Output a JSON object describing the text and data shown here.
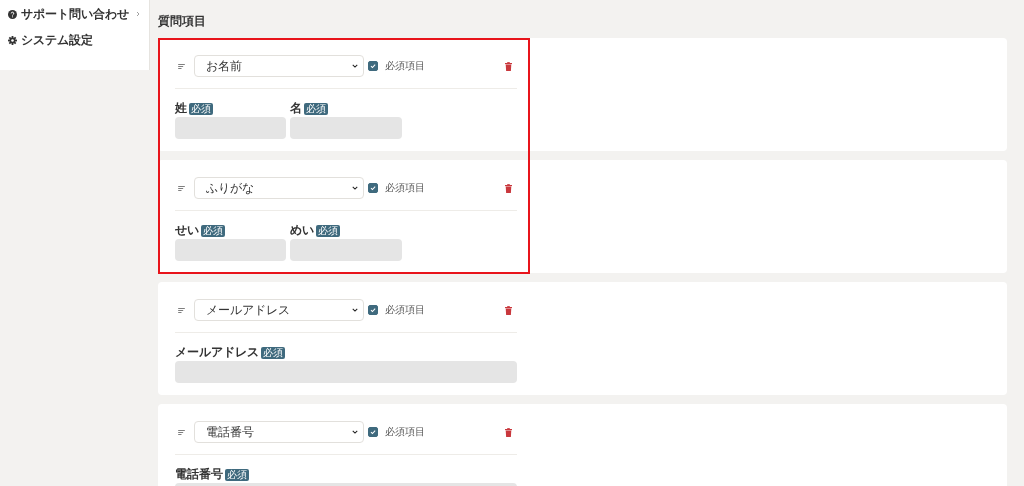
{
  "sidebar": {
    "items": [
      {
        "label": "サポート問い合わせ",
        "has_submenu": true
      },
      {
        "label": "システム設定",
        "has_submenu": false
      }
    ]
  },
  "section_title": "質問項目",
  "cards": [
    {
      "highlighted": true,
      "type": "お名前",
      "required_label": "必須項目",
      "required": true,
      "fields": [
        {
          "label": "姓",
          "badge": "必須"
        },
        {
          "label": "名",
          "badge": "必須"
        }
      ]
    },
    {
      "highlighted": true,
      "type": "ふりがな",
      "required_label": "必須項目",
      "required": true,
      "fields": [
        {
          "label": "せい",
          "badge": "必須"
        },
        {
          "label": "めい",
          "badge": "必須"
        }
      ]
    },
    {
      "highlighted": false,
      "type": "メールアドレス",
      "required_label": "必須項目",
      "required": true,
      "fields": [
        {
          "label": "メールアドレス",
          "badge": "必須"
        }
      ]
    },
    {
      "highlighted": false,
      "type": "電話番号",
      "required_label": "必須項目",
      "required": true,
      "fields": [
        {
          "label": "電話番号",
          "badge": "必須"
        }
      ]
    }
  ]
}
